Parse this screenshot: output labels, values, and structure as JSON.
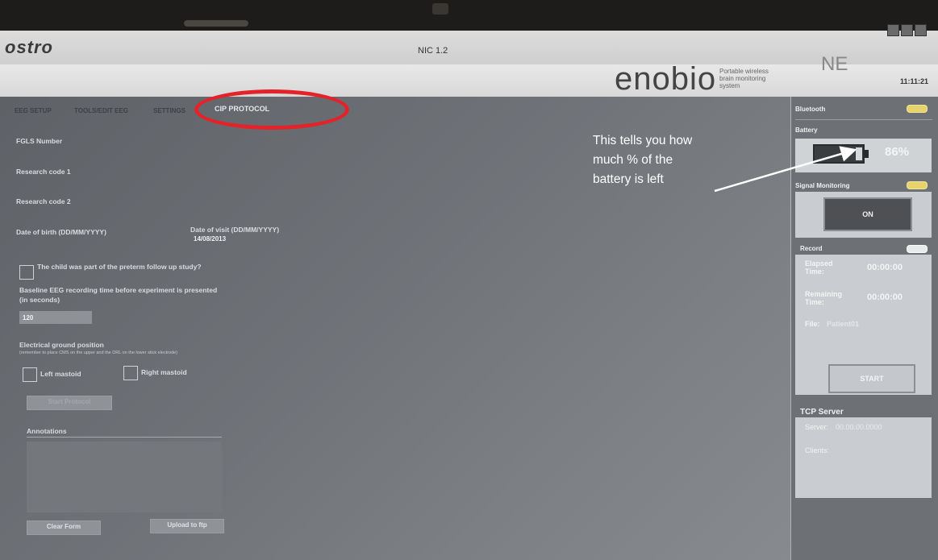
{
  "window": {
    "brand": "ostro",
    "title": "NIC 1.2"
  },
  "header": {
    "logo": "enobio",
    "tagline_line1": "Portable wireless",
    "tagline_line2": "brain monitoring",
    "tagline_line3": "system",
    "partner_logo": "NE",
    "clock": "11:11:21"
  },
  "tabs": [
    {
      "label": "EEG SETUP"
    },
    {
      "label": "TOOLS/EDIT EEG"
    },
    {
      "label": "SETTINGS"
    },
    {
      "label": "CIP PROTOCOL"
    }
  ],
  "form": {
    "fgls_label": "FGLS Number",
    "research1_label": "Research code 1",
    "research2_label": "Research code 2",
    "dob_label": "Date of birth (DD/MM/YYYY)",
    "dov_label": "Date of visit (DD/MM/YYYY)",
    "dov_value": "14/08/2013",
    "preterm_label": "The child was part of the preterm follow up study?",
    "baseline_label_line1": "Baseline EEG recording time before experiment is presented",
    "baseline_label_line2": "(in seconds)",
    "baseline_value": "120",
    "ground_label": "Electrical ground position",
    "ground_hint": "(remember to place CMS on the upper and the DRL on the lower stick electrode)",
    "left_mastoid": "Left mastoid",
    "right_mastoid": "Right mastoid",
    "start_protocol": "Start Protocol",
    "annotations_label": "Annotations",
    "clear_form": "Clear Form",
    "upload_ftp": "Upload to ftp"
  },
  "sidebar": {
    "bluetooth_label": "Bluetooth",
    "battery_label": "Battery",
    "battery_percent": "86%",
    "battery_level": 0.86,
    "signal_label": "Signal Monitoring",
    "signal_button": "ON",
    "record_label": "Record",
    "elapsed_line1": "Elapsed",
    "elapsed_line2": "Time:",
    "elapsed_value": "00:00:00",
    "remaining_line1": "Remaining",
    "remaining_line2": "Time:",
    "remaining_value": "00:00:00",
    "file_label": "File:",
    "file_value": "Patient01",
    "start_button": "START",
    "tcp_label": "TCP Server",
    "server_label": "Server:",
    "server_value": "00.00.00.0000",
    "clients_label": "Clients:"
  },
  "annotation": {
    "line1": "This tells you how",
    "line2": "much % of the",
    "line3": "battery is left"
  },
  "colors": {
    "highlight_circle": "#e3222a",
    "indicator": "#e6d36a"
  }
}
